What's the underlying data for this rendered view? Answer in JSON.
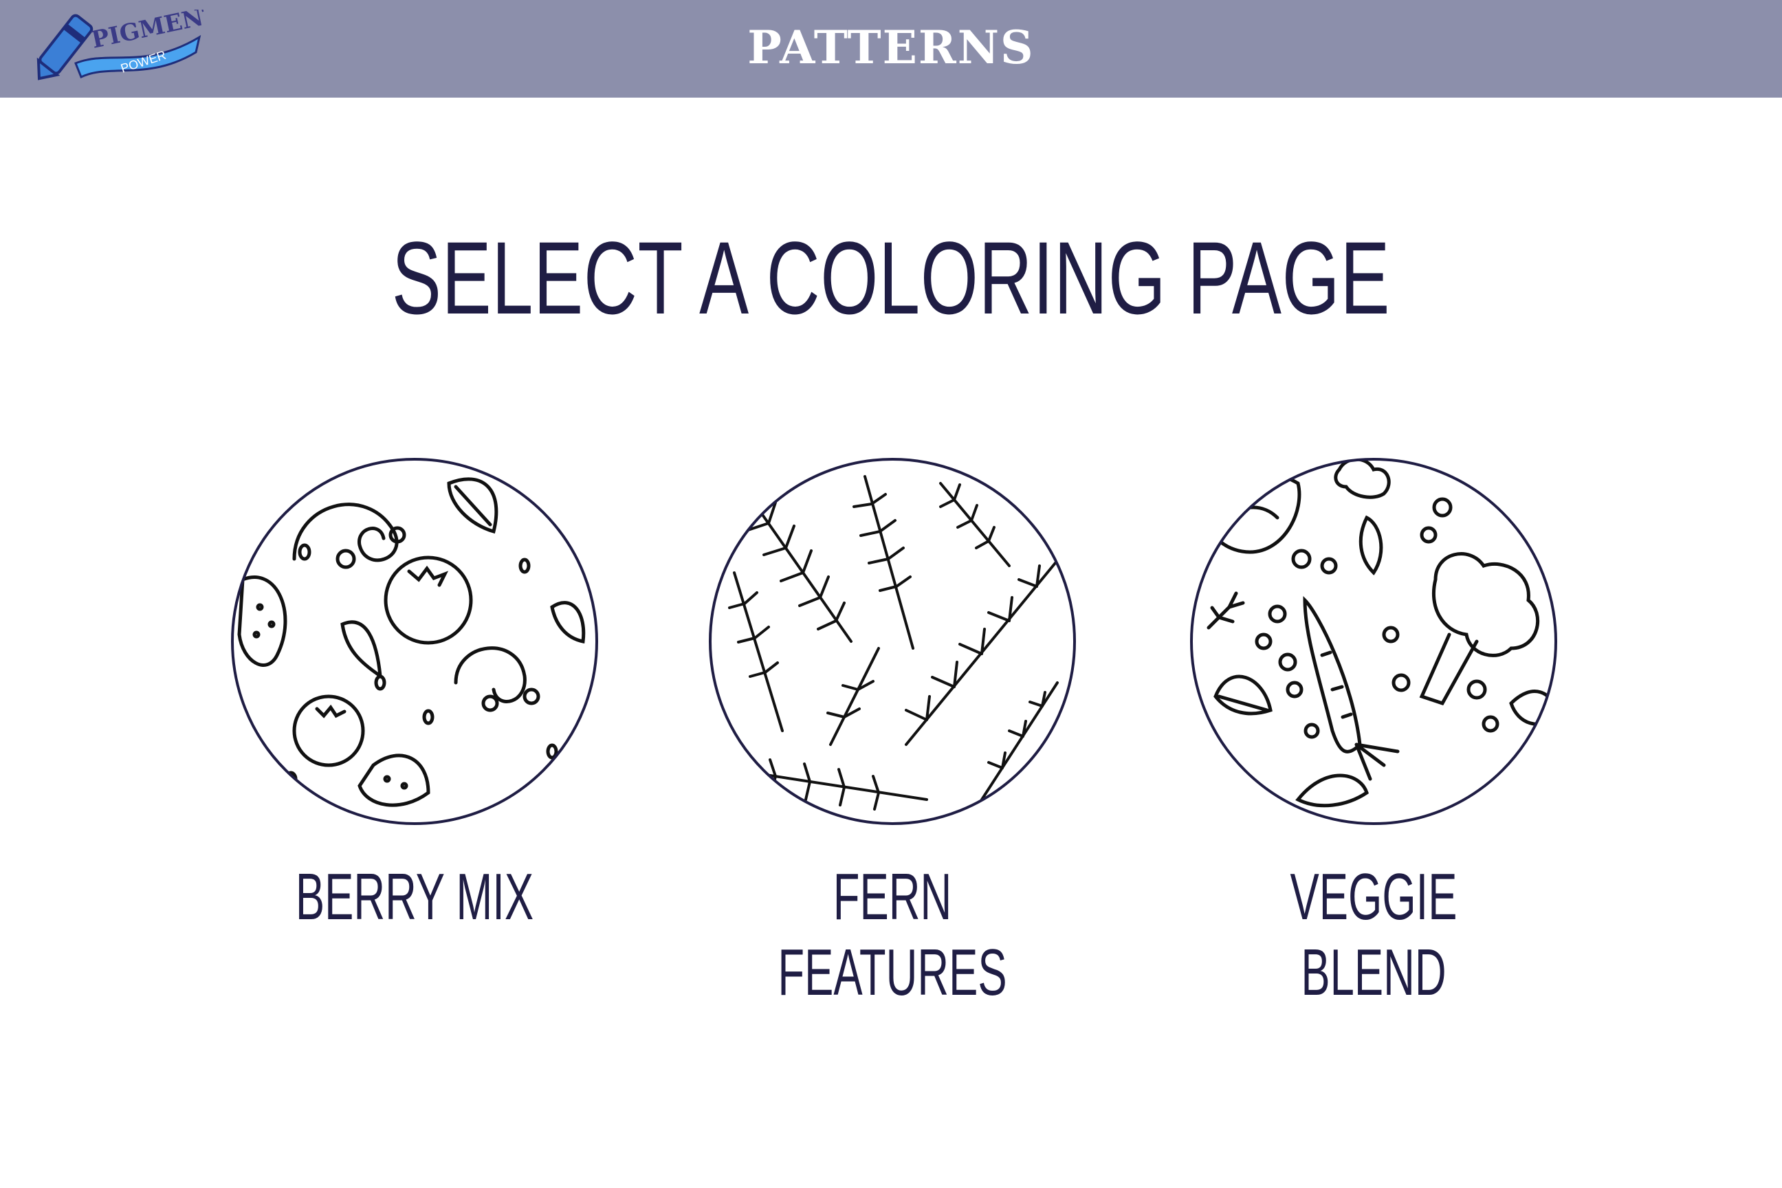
{
  "header": {
    "title": "PATTERNS",
    "logo": {
      "icon": "pigment-power-logo",
      "text_top": "PIGMENT",
      "text_bottom": "POWER"
    },
    "color": "#8c8fab"
  },
  "main": {
    "heading": "SELECT A COLORING PAGE",
    "pages": [
      {
        "label": "BERRY MIX",
        "icon": "berry-pattern-icon"
      },
      {
        "label": "FERN FEATURES",
        "icon": "fern-pattern-icon"
      },
      {
        "label": "VEGGIE BLEND",
        "icon": "veggie-pattern-icon"
      }
    ]
  },
  "colors": {
    "text": "#1f1d44",
    "line": "#111111",
    "accent": "#3a8fdc"
  }
}
